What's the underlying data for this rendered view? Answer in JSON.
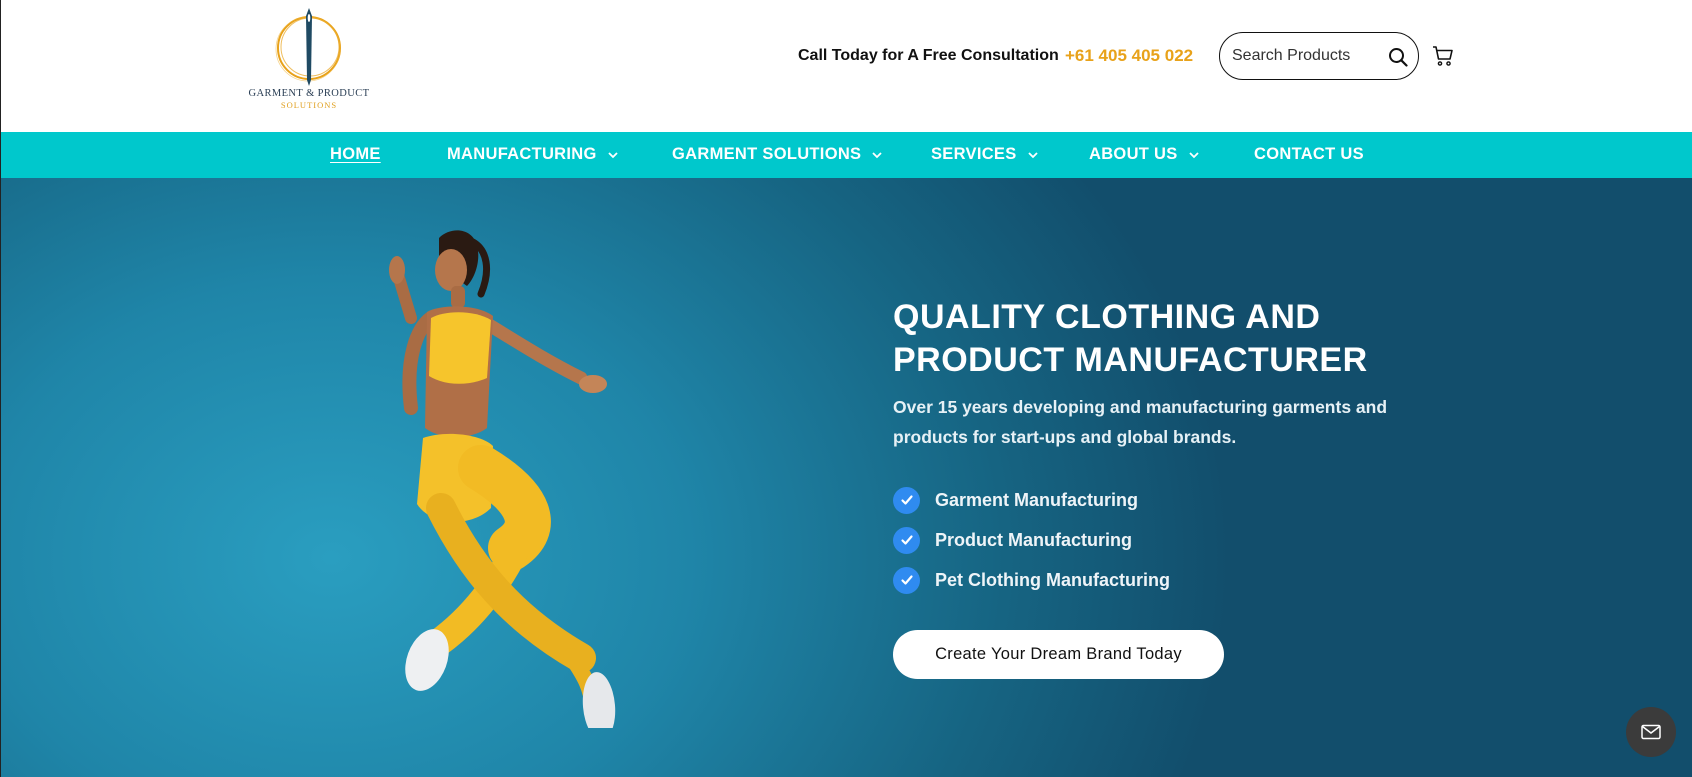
{
  "brand": {
    "name_line1": "GARMENT & PRODUCT",
    "name_line2": "SOLUTIONS"
  },
  "header": {
    "call_text": "Call Today for A Free Consultation",
    "phone": "+61 405 405 022",
    "search_placeholder": "Search Products"
  },
  "nav": {
    "items": [
      {
        "label": "HOME",
        "active": true,
        "has_dropdown": false
      },
      {
        "label": "MANUFACTURING",
        "active": false,
        "has_dropdown": true
      },
      {
        "label": "GARMENT SOLUTIONS",
        "active": false,
        "has_dropdown": true
      },
      {
        "label": "SERVICES",
        "active": false,
        "has_dropdown": true
      },
      {
        "label": "ABOUT US",
        "active": false,
        "has_dropdown": true
      },
      {
        "label": "CONTACT US",
        "active": false,
        "has_dropdown": false
      }
    ]
  },
  "hero": {
    "title_line1": "QUALITY CLOTHING AND",
    "title_line2": "PRODUCT MANUFACTURER",
    "subtitle": "Over 15 years developing and manufacturing garments and products for start-ups and global brands.",
    "checklist": [
      "Garment Manufacturing",
      "Product Manufacturing",
      "Pet Clothing Manufacturing"
    ],
    "cta_label": "Create Your Dream Brand Today"
  },
  "colors": {
    "accent_teal": "#00c8cc",
    "phone_orange": "#e8a21a",
    "check_blue": "#2f8bf0",
    "hero_bg": "#1f85a8"
  },
  "icons": {
    "search": "search-icon",
    "cart": "cart-icon",
    "check": "check-icon",
    "chevron": "chevron-down-icon",
    "mail": "mail-icon"
  }
}
